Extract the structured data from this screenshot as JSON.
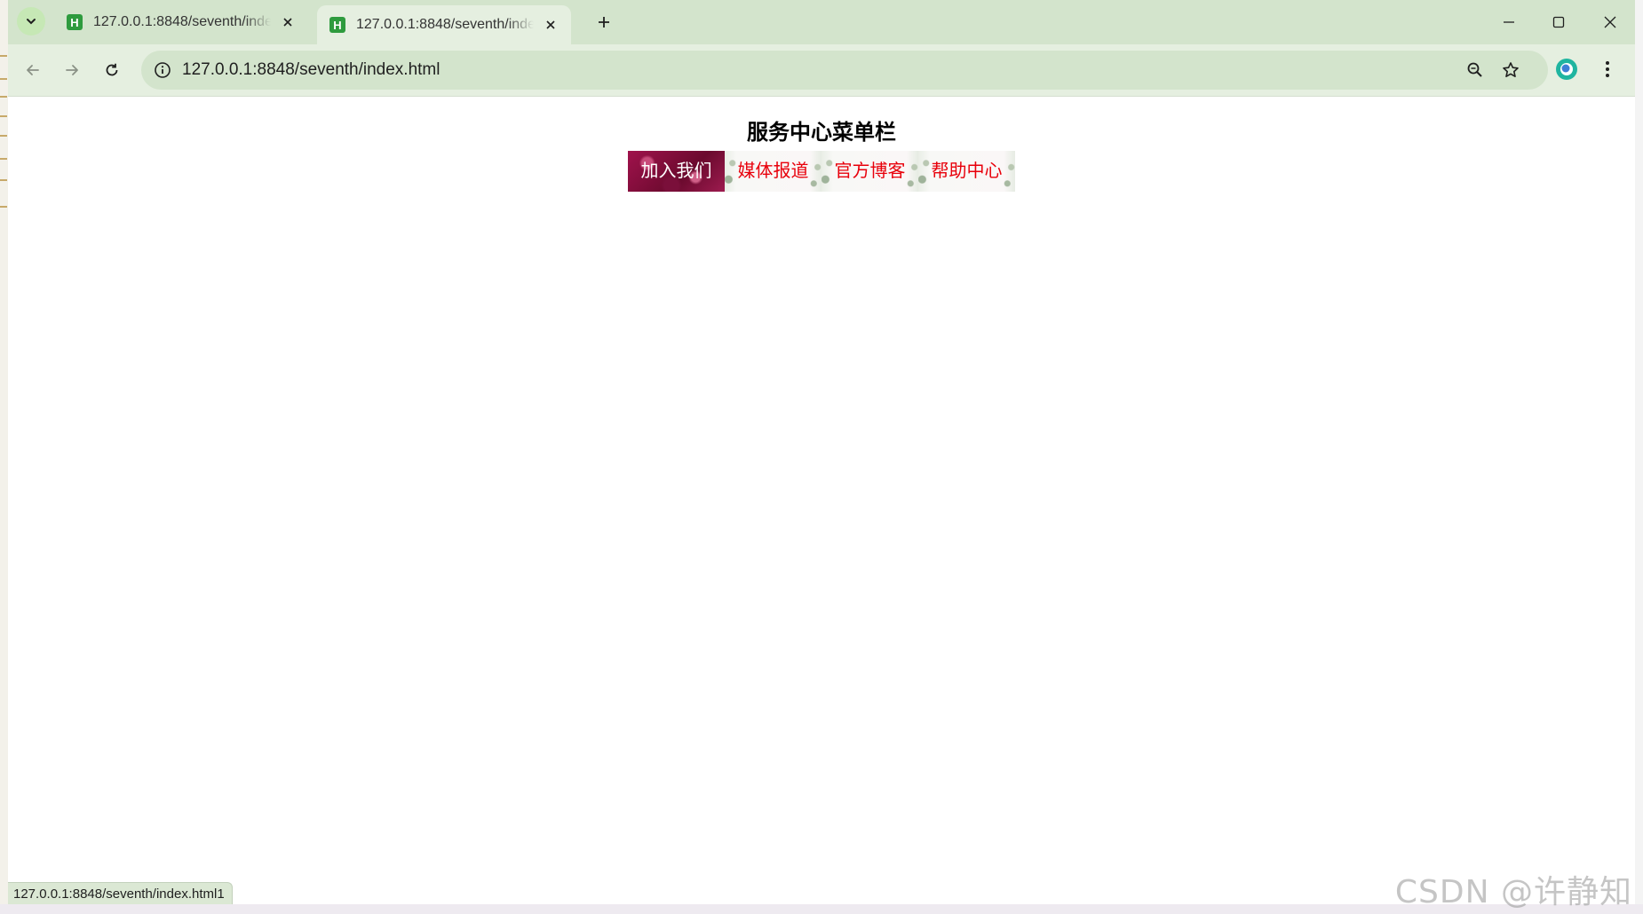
{
  "browser": {
    "tabs": [
      {
        "title": "127.0.0.1:8848/seventh/index.html",
        "favicon": "H",
        "active": false
      },
      {
        "title": "127.0.0.1:8848/seventh/index.html",
        "favicon": "H",
        "active": true
      }
    ],
    "address": "127.0.0.1:8848/seventh/index.html",
    "status_url": "127.0.0.1:8848/seventh/index.html1"
  },
  "page": {
    "heading": "服务中心菜单栏",
    "menu": [
      {
        "label": "加入我们",
        "active": true
      },
      {
        "label": "媒体报道",
        "active": false
      },
      {
        "label": "官方博客",
        "active": false
      },
      {
        "label": "帮助中心",
        "active": false
      }
    ]
  },
  "watermark": "CSDN @许静知",
  "colors": {
    "menu_text": "#e8000b",
    "menu_active_bg": "#8a0f3c",
    "tabstrip_bg": "#d3e4cc",
    "toolbar_bg": "#e5efe0"
  }
}
